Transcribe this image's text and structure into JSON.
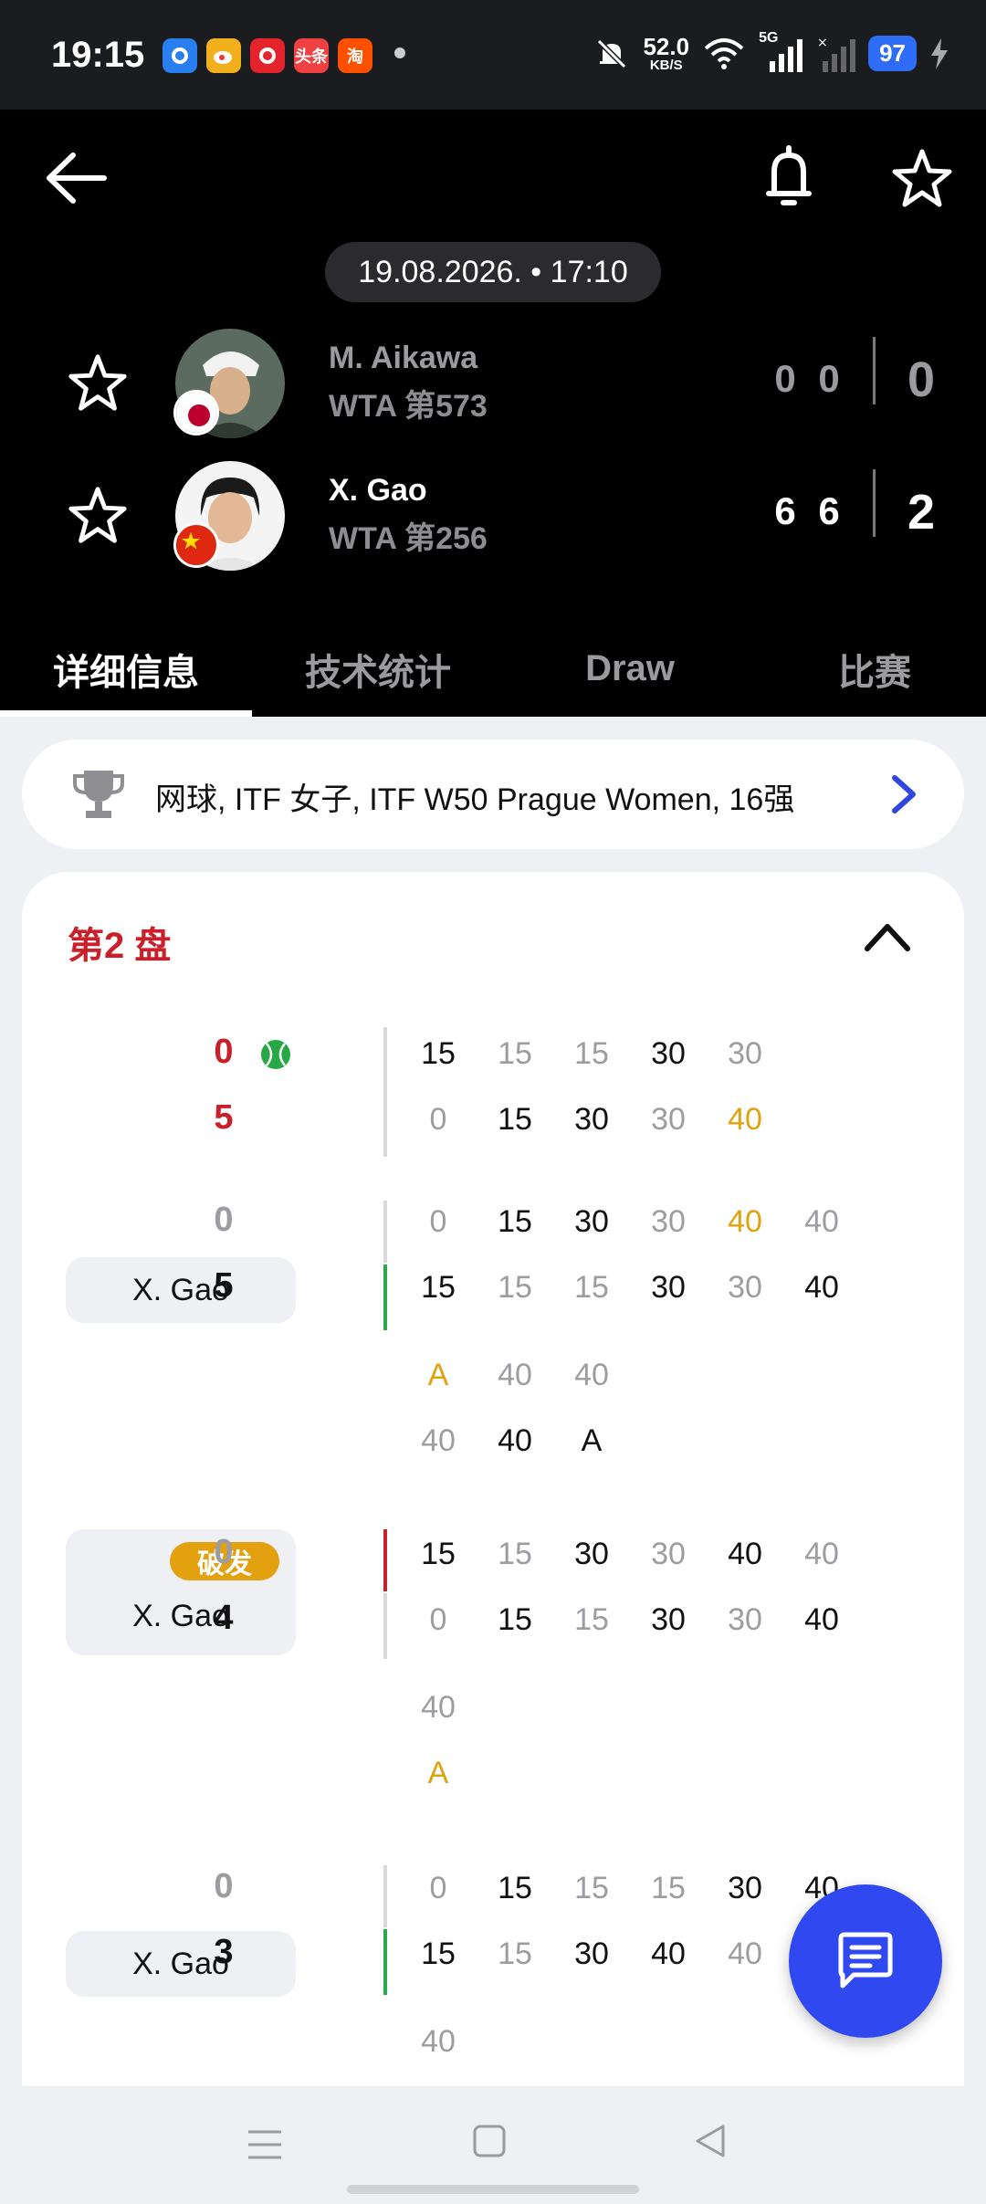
{
  "status_bar": {
    "time": "19:15",
    "net_speed": "52.0",
    "net_unit": "KB/S",
    "network": "5G",
    "battery": "97",
    "app_icons": [
      "browser-icon",
      "weibo-icon",
      "pinduoduo-icon",
      "toutiao-icon",
      "taobao-icon"
    ],
    "toutiao_label": "头条",
    "taobao_label": "淘"
  },
  "header": {
    "date": "19.08.2026. • 17:10",
    "players": [
      {
        "name": "M. Aikawa",
        "rank": "WTA 第573",
        "flag": "japan-flag",
        "sets": [
          "0",
          "0"
        ],
        "total": "0",
        "winner": false
      },
      {
        "name": "X. Gao",
        "rank": "WTA 第256",
        "flag": "china-flag",
        "sets": [
          "6",
          "6"
        ],
        "total": "2",
        "winner": true
      }
    ],
    "tabs": [
      "详细信息",
      "技术统计",
      "Draw",
      "比赛"
    ],
    "active_tab": 0
  },
  "tournament": {
    "text": "网球, ITF 女子, ITF W50 Prague Women, 16强"
  },
  "set": {
    "title": "第2 盘",
    "games": [
      {
        "score_top": "0",
        "score_bottom": "5",
        "score_color": "red",
        "serve_icon": "tennis-ball-icon",
        "bar_color": "#d9d9dd",
        "points_top": [
          [
            "15",
            "dark"
          ],
          [
            "15",
            "light"
          ],
          [
            "15",
            "light"
          ],
          [
            "30",
            "dark"
          ],
          [
            "30",
            "light"
          ]
        ],
        "points_bottom": [
          [
            "0",
            "light"
          ],
          [
            "15",
            "dark"
          ],
          [
            "30",
            "dark"
          ],
          [
            "30",
            "light"
          ],
          [
            "40",
            "gold"
          ]
        ]
      },
      {
        "score_top": "0",
        "score_bottom": "5",
        "score_color": "mixed",
        "winner_label": "X. Gao",
        "bar_color_top": "#d9d9dd",
        "bar_color_bottom": "#2aa84a",
        "points_top": [
          [
            "0",
            "light"
          ],
          [
            "15",
            "dark"
          ],
          [
            "30",
            "dark"
          ],
          [
            "30",
            "light"
          ],
          [
            "40",
            "gold"
          ],
          [
            "40",
            "light"
          ]
        ],
        "points_bottom": [
          [
            "15",
            "dark"
          ],
          [
            "15",
            "light"
          ],
          [
            "15",
            "light"
          ],
          [
            "30",
            "dark"
          ],
          [
            "30",
            "light"
          ],
          [
            "40",
            "dark"
          ]
        ],
        "deuce_top": [
          [
            "A",
            "gold"
          ],
          [
            "40",
            "light"
          ],
          [
            "40",
            "light"
          ]
        ],
        "deuce_bottom": [
          [
            "40",
            "light"
          ],
          [
            "40",
            "dark"
          ],
          [
            "A",
            "dark"
          ]
        ]
      },
      {
        "score_top": "0",
        "score_bottom": "4",
        "score_color": "mixed",
        "break_label": "破发",
        "winner_label": "X. Gao",
        "bar_color_top": "#c8212b",
        "bar_color_bottom": "#d9d9dd",
        "points_top": [
          [
            "15",
            "dark"
          ],
          [
            "15",
            "light"
          ],
          [
            "30",
            "dark"
          ],
          [
            "30",
            "light"
          ],
          [
            "40",
            "dark"
          ],
          [
            "40",
            "light"
          ]
        ],
        "points_bottom": [
          [
            "0",
            "light"
          ],
          [
            "15",
            "dark"
          ],
          [
            "15",
            "light"
          ],
          [
            "30",
            "dark"
          ],
          [
            "30",
            "light"
          ],
          [
            "40",
            "dark"
          ]
        ],
        "deuce_top": [
          [
            "40",
            "light"
          ]
        ],
        "deuce_bottom": [
          [
            "A",
            "gold"
          ]
        ]
      },
      {
        "score_top": "0",
        "score_bottom": "3",
        "score_color": "mixed",
        "winner_label": "X. Gao",
        "bar_color_top": "#d9d9dd",
        "bar_color_bottom": "#2aa84a",
        "points_top": [
          [
            "0",
            "light"
          ],
          [
            "15",
            "dark"
          ],
          [
            "15",
            "light"
          ],
          [
            "15",
            "light"
          ],
          [
            "30",
            "dark"
          ],
          [
            "40",
            "dark"
          ]
        ],
        "points_bottom": [
          [
            "15",
            "dark"
          ],
          [
            "15",
            "light"
          ],
          [
            "30",
            "dark"
          ],
          [
            "40",
            "dark"
          ],
          [
            "40",
            "light"
          ]
        ],
        "deuce_top": [
          [
            "40",
            "light"
          ]
        ]
      }
    ]
  },
  "fab": {
    "icon": "chat-icon"
  },
  "colors": {
    "accent_red": "#c8212b",
    "gold": "#e1a20f",
    "green": "#2aa84a",
    "fab_blue": "#3048f0"
  }
}
